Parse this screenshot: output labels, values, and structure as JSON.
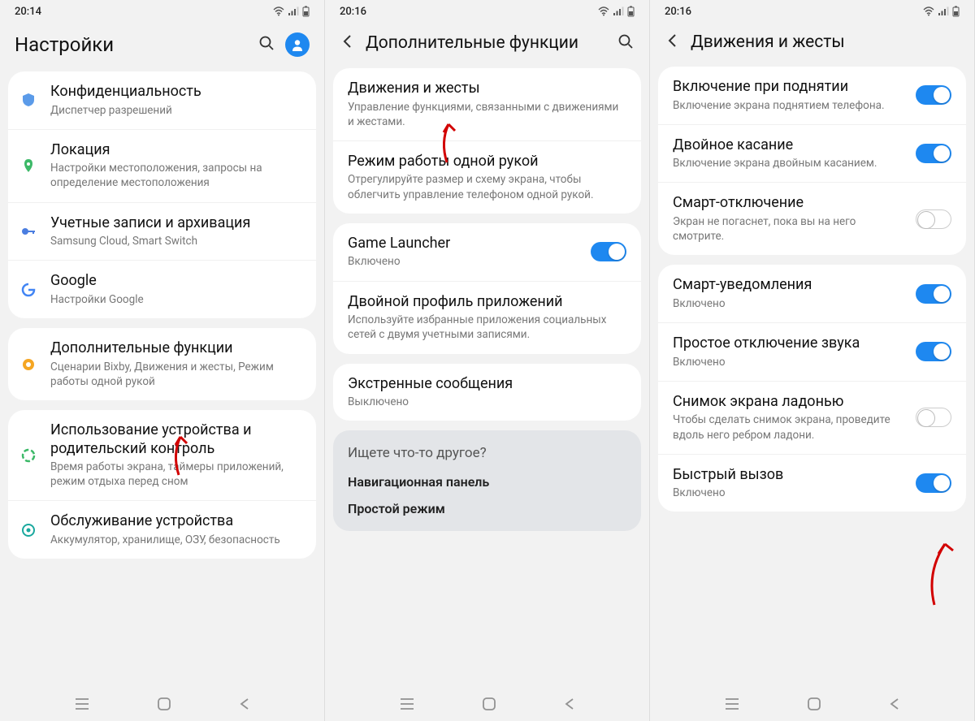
{
  "screens": {
    "s1": {
      "time": "20:14",
      "title": "Настройки",
      "sections": {
        "a": {
          "privacy": {
            "title": "Конфиденциальность",
            "sub": "Диспетчер разрешений"
          },
          "location": {
            "title": "Локация",
            "sub": "Настройки местоположения, запросы на определение местоположения"
          },
          "accounts": {
            "title": "Учетные записи и архивация",
            "sub": "Samsung Cloud, Smart Switch"
          },
          "google": {
            "title": "Google",
            "sub": "Настройки Google"
          }
        },
        "b": {
          "advanced": {
            "title": "Дополнительные функции",
            "sub": "Сценарии Bixby, Движения и жесты, Режим работы одной рукой"
          }
        },
        "c": {
          "wellbeing": {
            "title": "Использование устройства и родительский контроль",
            "sub": "Время работы экрана, таймеры приложений, режим отдыха перед сном"
          },
          "care": {
            "title": "Обслуживание устройства",
            "sub": "Аккумулятор, хранилище, ОЗУ, безопасность"
          }
        }
      }
    },
    "s2": {
      "time": "20:16",
      "title": "Дополнительные функции",
      "a": {
        "motions": {
          "title": "Движения и жесты",
          "sub": "Управление функциями, связанными с движениями и жестами."
        },
        "onehand": {
          "title": "Режим работы одной рукой",
          "sub": "Отрегулируйте размер и схему экрана, чтобы облегчить управление телефоном одной рукой."
        }
      },
      "b": {
        "gamelauncher": {
          "title": "Game Launcher",
          "sub": "Включено"
        },
        "dualmsg": {
          "title": "Двойной профиль приложений",
          "sub": "Используйте избранные приложения социальных сетей с двумя учетными записями."
        }
      },
      "c": {
        "sos": {
          "title": "Экстренные сообщения",
          "sub": "Выключено"
        }
      },
      "other": {
        "heading": "Ищете что-то другое?",
        "nav": "Навигационная панель",
        "easy": "Простой режим"
      }
    },
    "s3": {
      "time": "20:16",
      "title": "Движения и жесты",
      "a": {
        "lifttowake": {
          "title": "Включение при поднятии",
          "sub": "Включение экрана поднятием телефона."
        },
        "doubletap": {
          "title": "Двойное касание",
          "sub": "Включение экрана двойным касанием."
        },
        "smartstay": {
          "title": "Смарт-отключение",
          "sub": "Экран не погаснет, пока вы на него смотрите."
        }
      },
      "b": {
        "smartalert": {
          "title": "Смарт-уведомления",
          "sub": "Включено"
        },
        "easymute": {
          "title": "Простое отключение звука",
          "sub": "Включено"
        },
        "palmswipe": {
          "title": "Снимок экрана ладонью",
          "sub": "Чтобы сделать снимок экрана, проведите вдоль него ребром ладони."
        },
        "directcall": {
          "title": "Быстрый вызов",
          "sub": "Включено"
        }
      }
    }
  }
}
